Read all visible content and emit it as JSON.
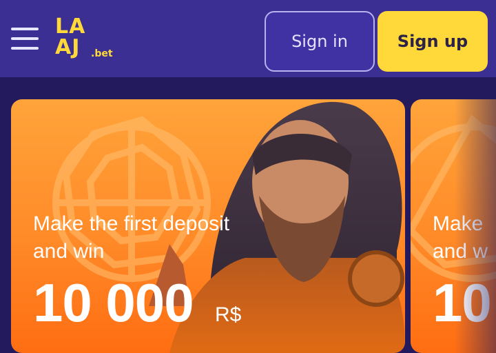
{
  "header": {
    "logo_line1": "LA",
    "logo_line2": "AJ",
    "logo_tld": ".bet",
    "signin_label": "Sign in",
    "signup_label": "Sign up"
  },
  "banners": [
    {
      "line1": "Make the first deposit",
      "line2": "and win",
      "amount": "10 000",
      "currency": "R$"
    },
    {
      "line1": "Make",
      "line2": "and w",
      "amount": "10",
      "currency": ""
    }
  ],
  "colors": {
    "header_bg": "#3c2f93",
    "page_bg": "#221a5c",
    "accent_yellow": "#ffd83a",
    "banner_orange": "#ff8a28"
  },
  "icons": [
    "menu-icon"
  ]
}
